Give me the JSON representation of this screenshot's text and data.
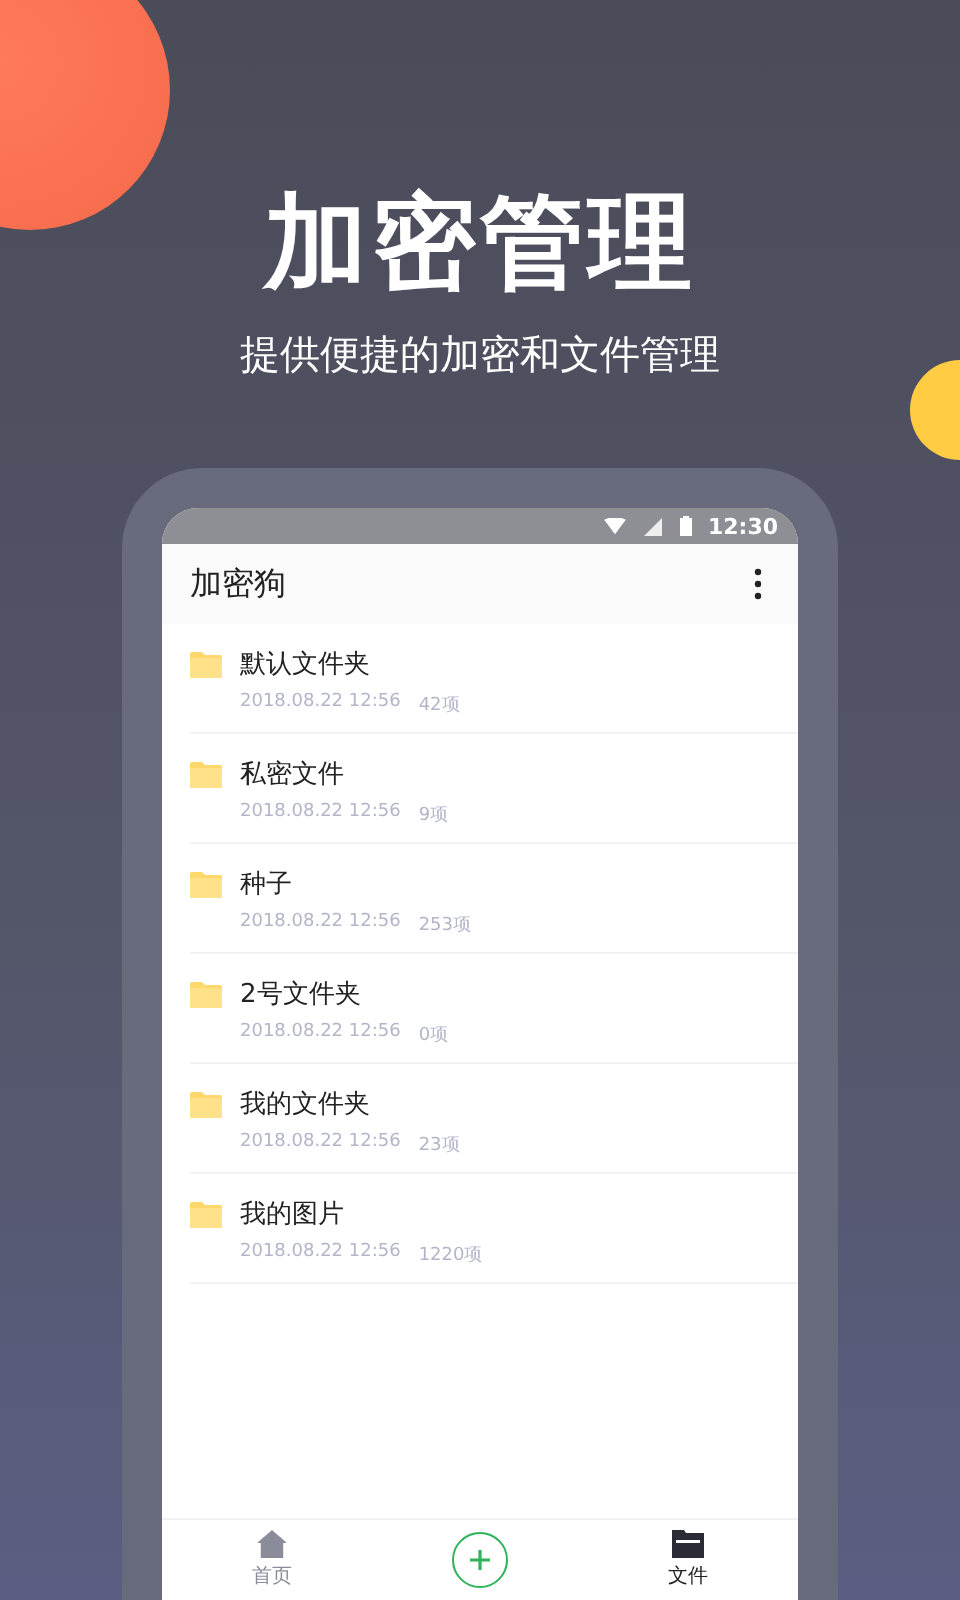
{
  "hero": {
    "title": "加密管理",
    "subtitle": "提供便捷的加密和文件管理"
  },
  "status_bar": {
    "time": "12:30"
  },
  "app_bar": {
    "title": "加密狗"
  },
  "folders": [
    {
      "name": "默认文件夹",
      "date": "2018.08.22 12:56",
      "count": "42项"
    },
    {
      "name": "私密文件",
      "date": "2018.08.22 12:56",
      "count": "9项"
    },
    {
      "name": "种子",
      "date": "2018.08.22 12:56",
      "count": "253项"
    },
    {
      "name": "2号文件夹",
      "date": "2018.08.22 12:56",
      "count": "0项"
    },
    {
      "name": "我的文件夹",
      "date": "2018.08.22 12:56",
      "count": "23项"
    },
    {
      "name": "我的图片",
      "date": "2018.08.22 12:56",
      "count": "1220项"
    }
  ],
  "bottom_nav": [
    {
      "kind": "home",
      "label": "首页",
      "selected": false
    },
    {
      "kind": "add"
    },
    {
      "kind": "files",
      "label": "文件",
      "selected": true
    }
  ]
}
